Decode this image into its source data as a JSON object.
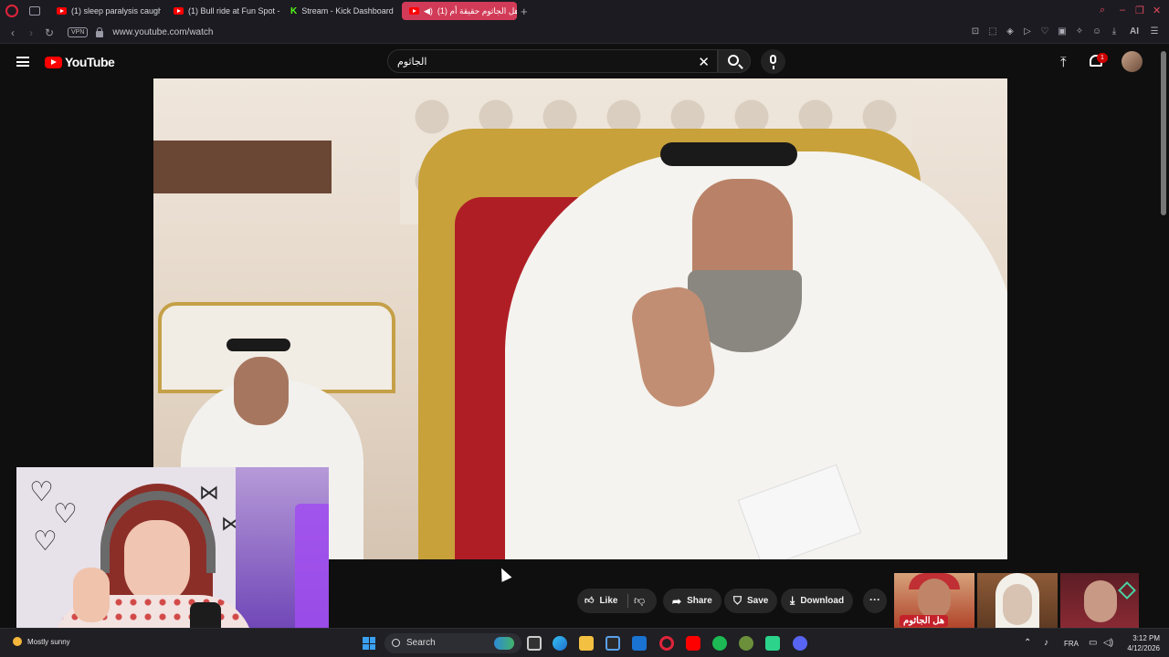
{
  "browser": {
    "tabs": [
      {
        "label": "(1) sleep paralysis caught",
        "icon": "youtube-icon",
        "active": false
      },
      {
        "label": "(1) Bull ride at Fun Spot - Y",
        "icon": "youtube-icon",
        "active": false
      },
      {
        "label": "Stream - Kick Dashboard",
        "icon": "kick-icon",
        "active": false
      },
      {
        "label": "(1) هل الجاثوم حقيقة أم",
        "icon": "youtube-icon",
        "active": true
      }
    ],
    "vpn_label": "VPN",
    "url": "www.youtube.com/watch",
    "ai_label": "AI"
  },
  "youtube": {
    "logo_text": "YouTube",
    "search_value": "الجاثوم",
    "notification_count": "1"
  },
  "actions": {
    "like": "Like",
    "share": "Share",
    "save": "Save",
    "download": "Download"
  },
  "recommended": [
    {
      "overlay_text": "هل الجاثوم"
    },
    {
      "overlay_text": ""
    },
    {
      "overlay_text": ""
    }
  ],
  "taskbar": {
    "weather": "Mostly sunny",
    "search_label": "Search",
    "language": "FRA",
    "time": "3:12 PM",
    "date": "4/12/2026"
  },
  "colors": {
    "youtube_red": "#ff0000",
    "active_tab": "#d23b57",
    "kick_green": "#53fc18",
    "page_bg": "#0f0f0f"
  }
}
